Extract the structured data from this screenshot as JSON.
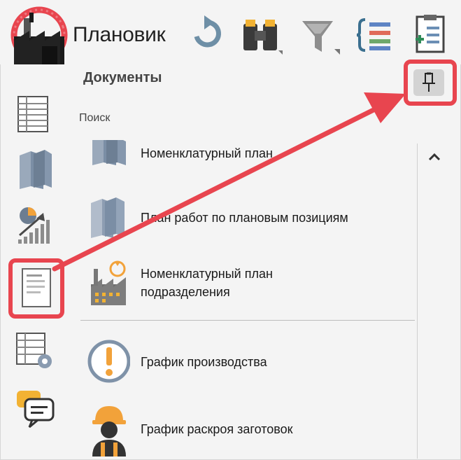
{
  "app": {
    "title": "Плановик"
  },
  "toolbar": {
    "buttons": [
      {
        "name": "refresh",
        "icon": "refresh-icon"
      },
      {
        "name": "search",
        "icon": "binoculars-icon"
      },
      {
        "name": "filter",
        "icon": "filter-icon"
      },
      {
        "name": "list-format",
        "icon": "list-braces-icon"
      },
      {
        "name": "add-document",
        "icon": "document-add-icon"
      }
    ]
  },
  "sidebar": {
    "items": [
      {
        "name": "table",
        "icon": "table-icon"
      },
      {
        "name": "books",
        "icon": "books-icon"
      },
      {
        "name": "analytics",
        "icon": "chart-growth-icon"
      },
      {
        "name": "documents",
        "icon": "document-icon",
        "selected": true
      },
      {
        "name": "table-settings",
        "icon": "table-gear-icon"
      },
      {
        "name": "messages",
        "icon": "chat-icon"
      }
    ]
  },
  "panel": {
    "title": "Документы",
    "search_label": "Поиск",
    "pin_icon": "pin-icon"
  },
  "list": [
    {
      "label": "Номенклатурный план",
      "icon": "books-icon"
    },
    {
      "label": "План работ по плановым позициям",
      "icon": "books-icon"
    },
    {
      "label": "Номенклатурный план подразделения",
      "icon": "factory-icon"
    },
    {
      "label": "График производства",
      "icon": "warning-circle-icon"
    },
    {
      "label": "График раскроя заготовок",
      "icon": "worker-icon"
    }
  ],
  "colors": {
    "highlight": "#e8454f",
    "accent": "#ff6a1a",
    "text": "#1a1a1a"
  }
}
